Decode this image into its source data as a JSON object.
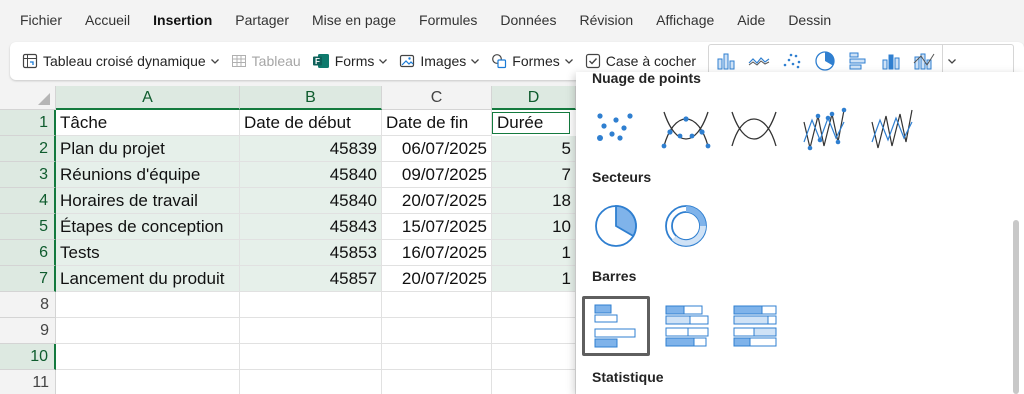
{
  "menu": {
    "tabs": [
      "Fichier",
      "Accueil",
      "Insertion",
      "Partager",
      "Mise en page",
      "Formules",
      "Données",
      "Révision",
      "Affichage",
      "Aide",
      "Dessin"
    ],
    "active": "Insertion"
  },
  "ribbon": {
    "pivot": "Tableau croisé dynamique",
    "table": "Tableau",
    "forms": "Forms",
    "images": "Images",
    "shapes": "Formes",
    "checkbox": "Case à cocher"
  },
  "sheet": {
    "columns": [
      "A",
      "B",
      "C",
      "D"
    ],
    "rows": [
      "1",
      "2",
      "3",
      "4",
      "5",
      "6",
      "7",
      "8",
      "9",
      "10",
      "11"
    ],
    "header": [
      "Tâche",
      "Date de début",
      "Date de fin",
      "Durée"
    ],
    "data": [
      [
        "Plan du projet",
        "45839",
        "06/07/2025",
        "5"
      ],
      [
        "Réunions d'équipe",
        "45840",
        "09/07/2025",
        "7"
      ],
      [
        "Horaires de travail",
        "45840",
        "20/07/2025",
        "18"
      ],
      [
        "Étapes de conception",
        "45843",
        "15/07/2025",
        "10"
      ],
      [
        "Tests",
        "45853",
        "16/07/2025",
        "1"
      ],
      [
        "Lancement du produit",
        "45857",
        "20/07/2025",
        "1"
      ]
    ]
  },
  "chart_menu": {
    "scatter_title": "Nuage de points",
    "pie_title": "Secteurs",
    "bar_title": "Barres",
    "stat_title": "Statistique"
  },
  "colors": {
    "accent": "#137a3e",
    "chart_blue": "#3a87d6",
    "selection_fill": "#e6f0ea"
  }
}
